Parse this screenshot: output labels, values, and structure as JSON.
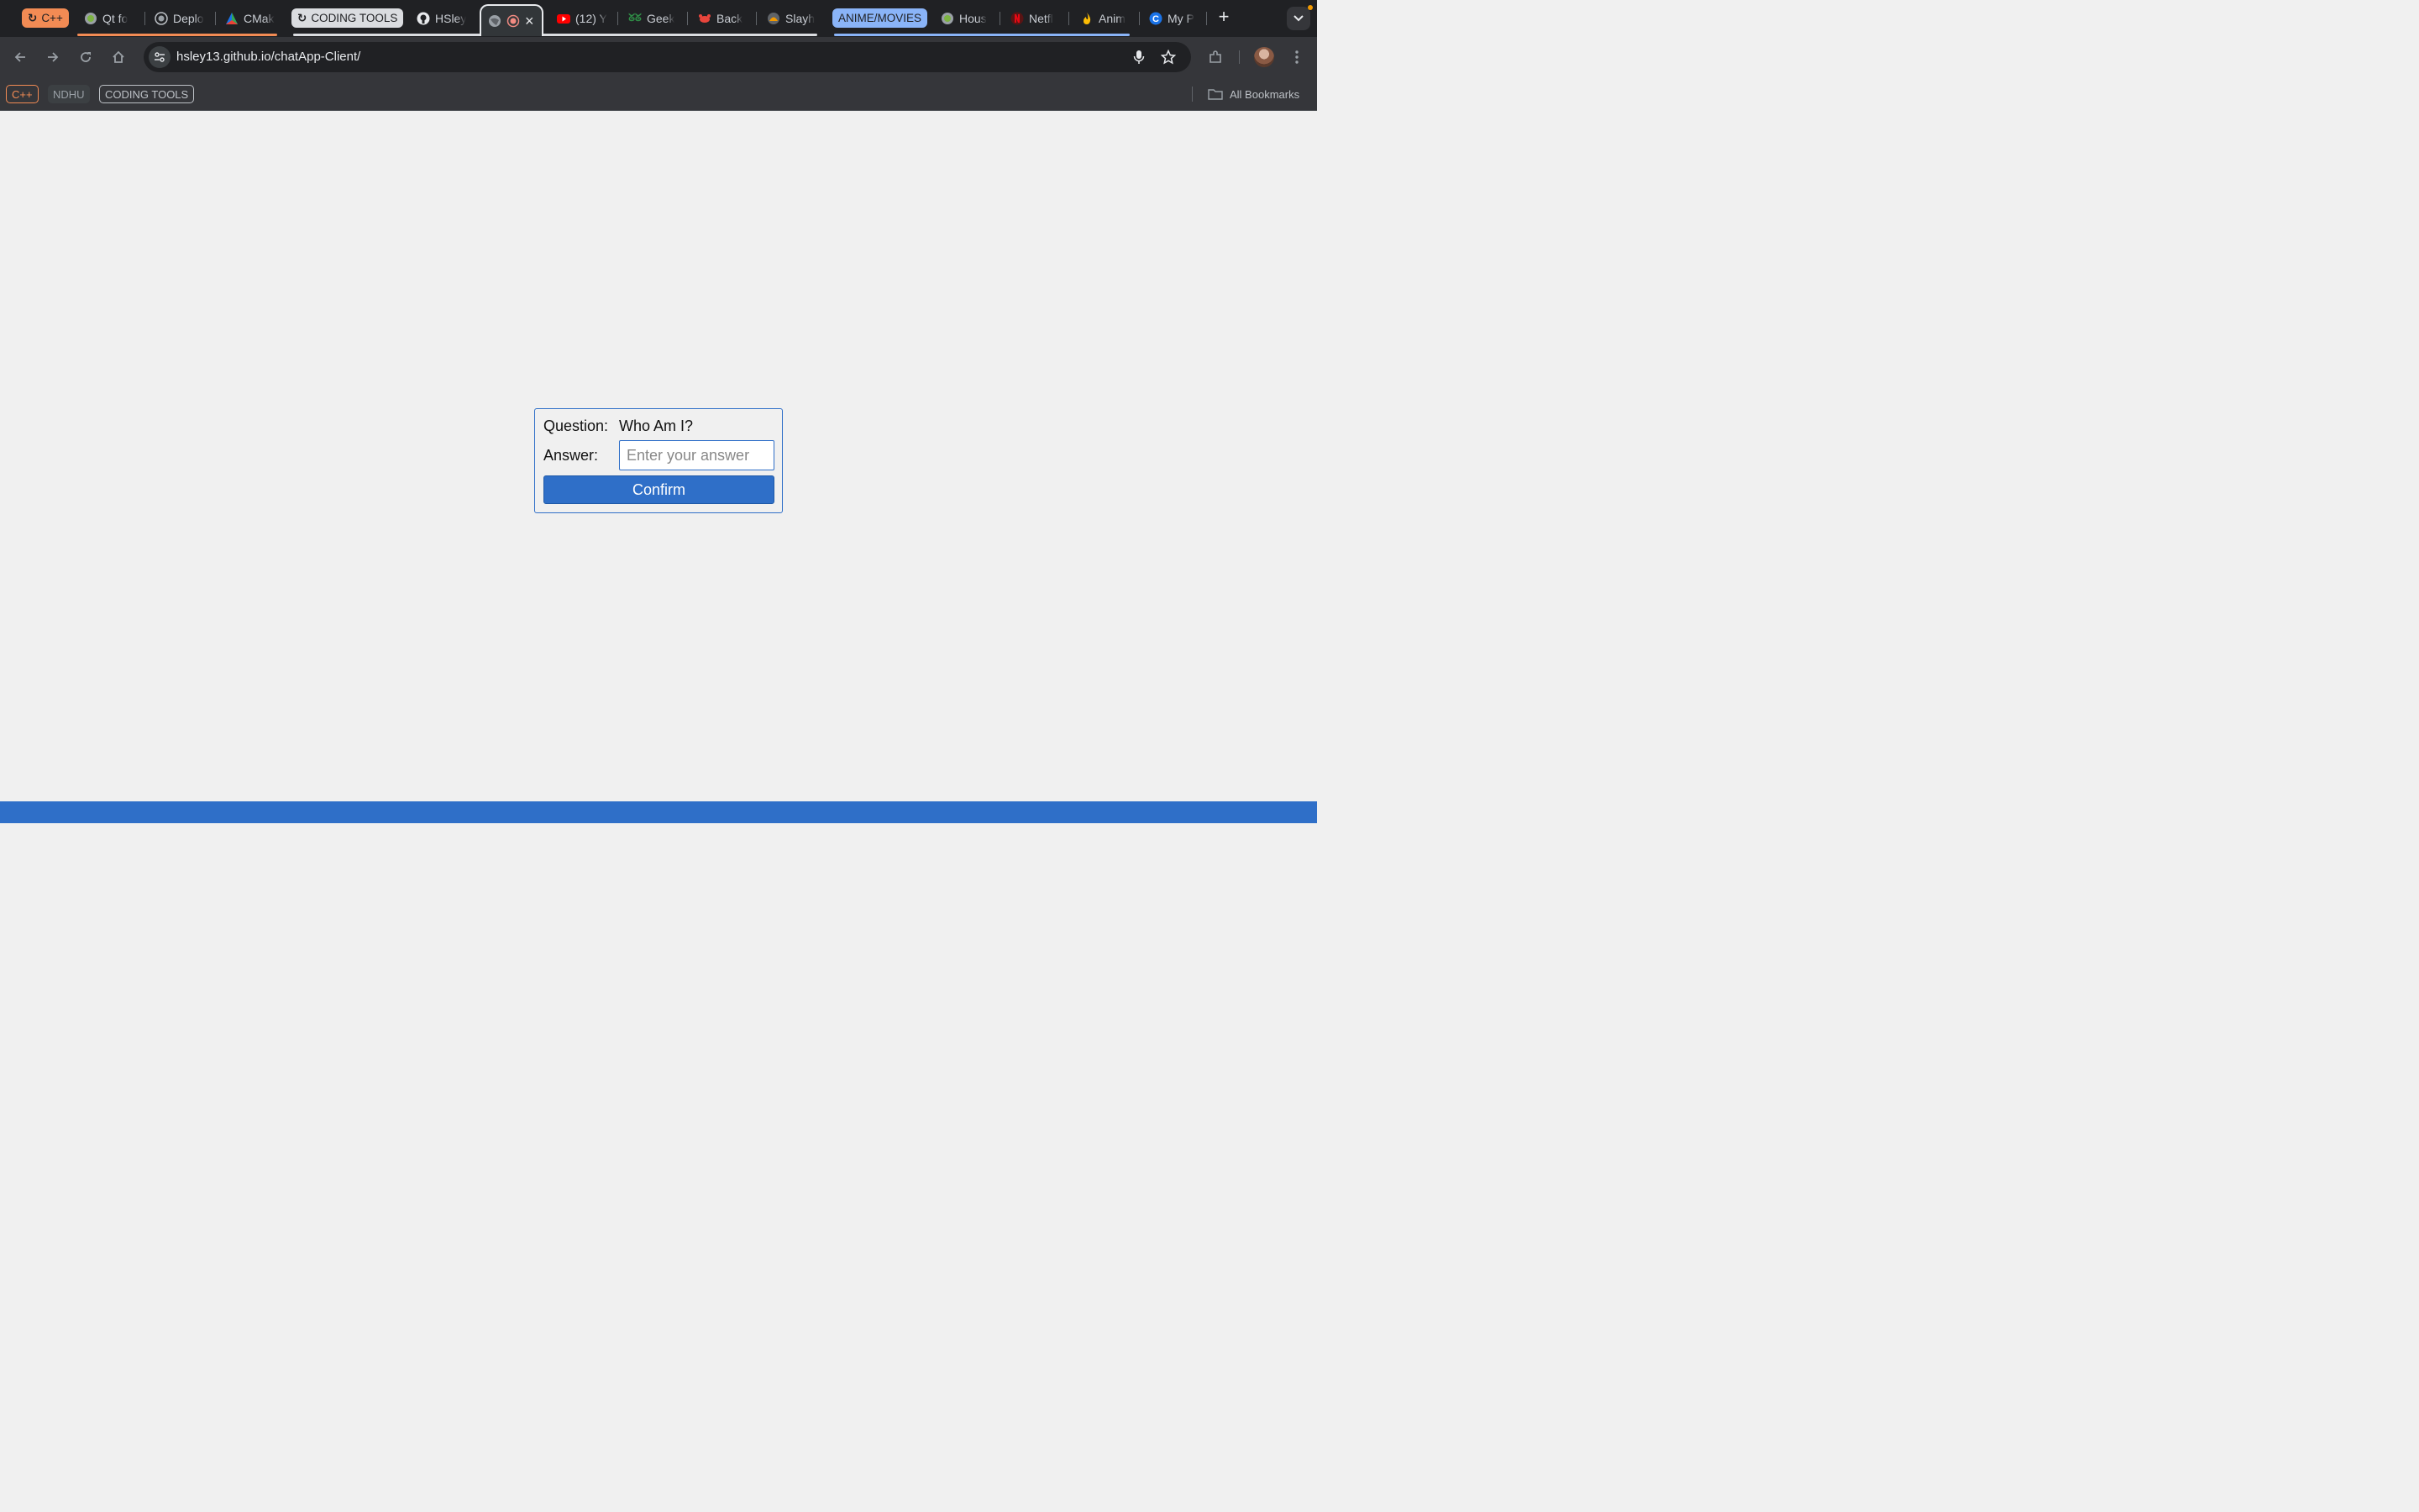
{
  "browser": {
    "tab_groups": [
      {
        "label": "C++",
        "color": "#f28b54",
        "text_color": "#202124"
      },
      {
        "label": "CODING TOOLS",
        "color": "#dadce0",
        "text_color": "#202124"
      },
      {
        "label": "ANIME/MOVIES",
        "color": "#8ab4f8",
        "text_color": "#202124"
      }
    ],
    "tabs": [
      {
        "title": "Qt fo",
        "icon": "qt-globe-icon"
      },
      {
        "title": "Deplo",
        "icon": "globe-icon"
      },
      {
        "title": "CMak",
        "icon": "cmake-triangle-icon"
      },
      {
        "title": "HSley",
        "icon": "github-icon"
      },
      {
        "title": "(12) Y",
        "icon": "youtube-icon"
      },
      {
        "title": "Geek",
        "icon": "geeksforgeeks-icon"
      },
      {
        "title": "Back",
        "icon": "crab-icon"
      },
      {
        "title": "Slayh",
        "icon": "slay-icon"
      },
      {
        "title": "Hous",
        "icon": "globe-icon"
      },
      {
        "title": "Netfl",
        "icon": "netflix-icon"
      },
      {
        "title": "Anim",
        "icon": "flame-icon"
      },
      {
        "title": "My P",
        "icon": "c-logo-icon"
      }
    ],
    "active_tab": {
      "icons": [
        "globe-icon",
        "record-icon"
      ],
      "close": "×"
    },
    "new_tab": "+",
    "url": "hsley13.github.io/chatApp-Client/",
    "bookmarks": [
      {
        "label": "C++",
        "color": "#f28b54"
      },
      {
        "label": "NDHU",
        "color": "#9aa0a6"
      },
      {
        "label": "CODING TOOLS",
        "color": "#bdc1c6"
      }
    ],
    "all_bookmarks": "All Bookmarks"
  },
  "page": {
    "question_label": "Question:",
    "question_text": "Who Am I?",
    "answer_label": "Answer:",
    "answer_placeholder": "Enter your answer",
    "answer_value": "",
    "confirm_label": "Confirm",
    "accent_color": "#2f6fc8",
    "background_color": "#f0f0f0"
  }
}
